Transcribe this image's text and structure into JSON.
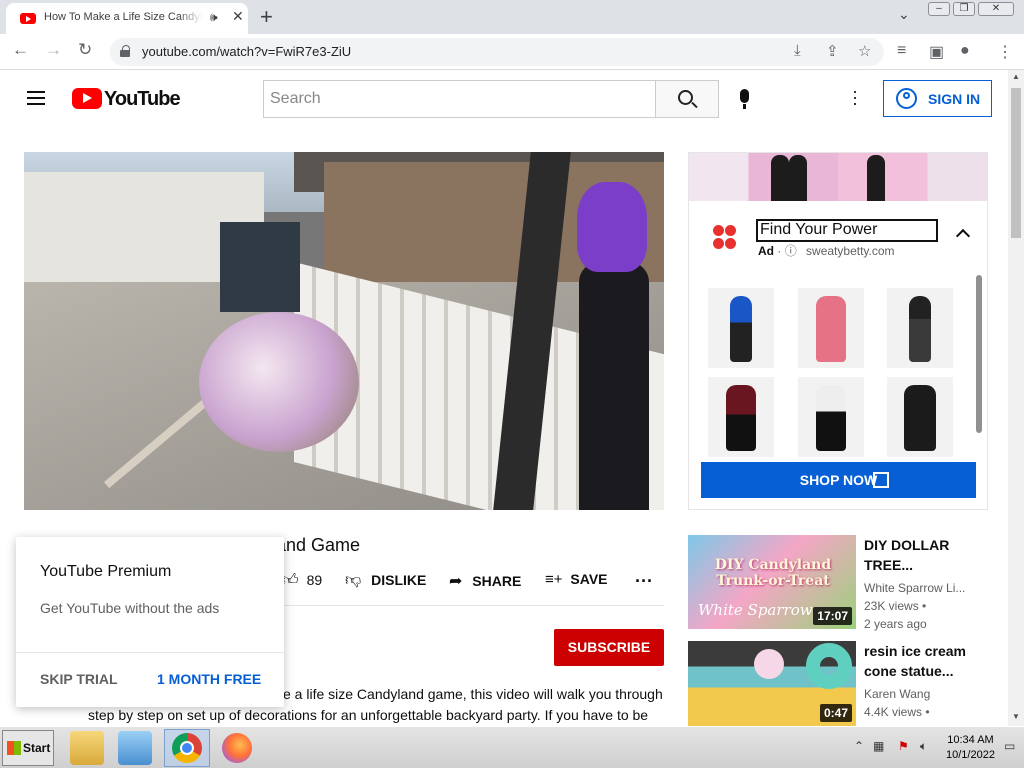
{
  "browser": {
    "tab_title": "How To Make a Life Size Candyland Game",
    "url": "youtube.com/watch?v=FwiR7e3-ZiU"
  },
  "header": {
    "logo_text": "YouTube",
    "search_placeholder": "Search",
    "sign_in_label": "SIGN IN"
  },
  "video": {
    "title_visible": "land Game",
    "likes": "89",
    "dislike_label": "DISLIKE",
    "share_label": "SHARE",
    "save_label": "SAVE",
    "subscribe_label": "SUBSCRIBE",
    "description_line1": "e a life size Candyland game, this video will walk you through",
    "description_line2": "step by step on set up of decorations for an unforgettable backyard party. If you have to be"
  },
  "ad": {
    "headline": "Find Your Power",
    "ad_label": "Ad",
    "domain": "sweatybetty.com",
    "cta_label": "SHOP NOW"
  },
  "related": [
    {
      "title": "DIY DOLLAR TREE...",
      "channel": "White Sparrow Li...",
      "views": "23K views",
      "age": "2 years ago",
      "duration": "17:07",
      "thumb_text": "DIY Candyland Trunk-or-Treat",
      "thumb_sub": "White Sparrow"
    },
    {
      "title": "resin ice cream cone statue...",
      "channel": "Karen Wang",
      "views": "4.4K views",
      "duration": "0:47"
    }
  ],
  "premium_popup": {
    "title": "YouTube Premium",
    "subtitle": "Get YouTube without the ads",
    "skip_label": "SKIP TRIAL",
    "free_label": "1 MONTH FREE"
  },
  "taskbar": {
    "start_label": "Start",
    "time": "10:34 AM",
    "date": "10/1/2022"
  },
  "colors": {
    "yt_red": "#ff0000",
    "link_blue": "#065fd4",
    "subscribe_red": "#cc0000"
  }
}
